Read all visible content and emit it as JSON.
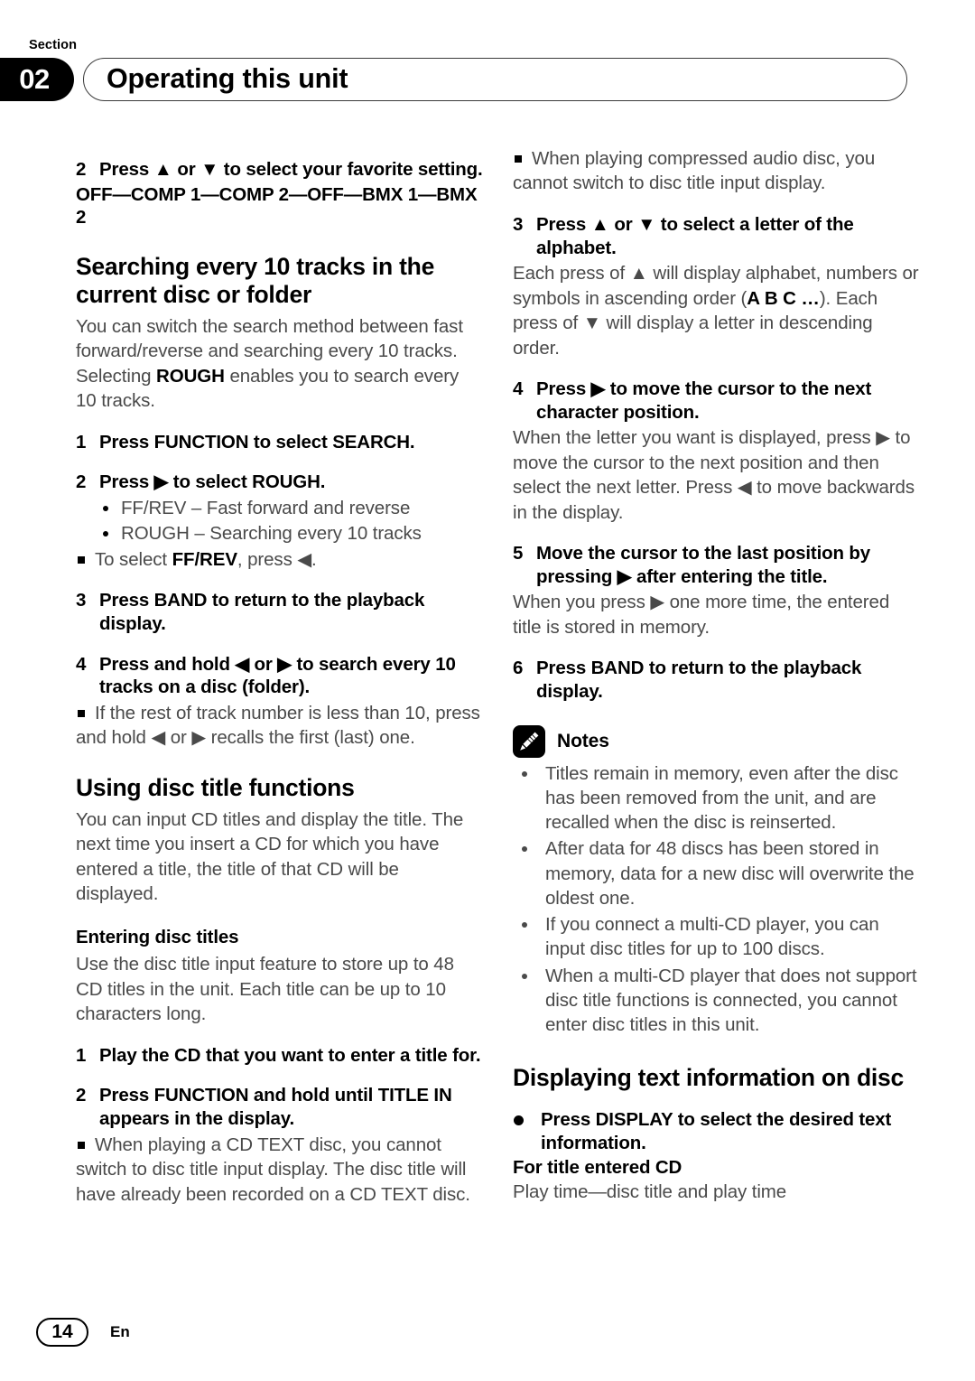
{
  "header": {
    "section_label": "Section",
    "section_number": "02",
    "title": "Operating this unit"
  },
  "footer": {
    "page_number": "14",
    "language_code": "En"
  },
  "left_column": {
    "step2_setting": {
      "number": "2",
      "text": "Press ▲ or ▼ to select your favorite setting.",
      "values": "OFF—COMP 1—COMP 2—OFF—BMX 1—BMX 2"
    },
    "search_section": {
      "heading": "Searching every 10 tracks in the current disc or folder",
      "intro_a": "You can switch the search method between fast forward/reverse and searching every 10 tracks. Selecting ",
      "intro_bold": "ROUGH",
      "intro_b": " enables you to search every 10 tracks.",
      "step1": {
        "number": "1",
        "text": "Press FUNCTION to select SEARCH."
      },
      "step2": {
        "number": "2",
        "text": "Press ▶ to select ROUGH."
      },
      "options": [
        {
          "term": "FF/REV",
          "desc": " – Fast forward and reverse"
        },
        {
          "term": "ROUGH",
          "desc": " – Searching every 10 tracks"
        }
      ],
      "note_a": "To select ",
      "note_bold": "FF/REV",
      "note_b": ", press ◀.",
      "step3": {
        "number": "3",
        "text": "Press BAND to return to the playback display."
      },
      "step4": {
        "number": "4",
        "text": "Press and hold ◀ or ▶ to search every 10 tracks on a disc (folder)."
      },
      "step4_note": "If the rest of track number is less than 10, press and hold ◀ or ▶ recalls the first (last) one."
    },
    "disc_title_section": {
      "heading": "Using disc title functions",
      "intro": "You can input CD titles and display the title. The next time you insert a CD for which you have entered a title, the title of that CD will be displayed.",
      "subheading": "Entering disc titles",
      "sub_intro": "Use the disc title input feature to store up to 48 CD titles in the unit. Each title can be up to 10 characters long.",
      "step1": {
        "number": "1",
        "text": "Play the CD that you want to enter a title for."
      },
      "step2": {
        "number": "2",
        "text": "Press FUNCTION and hold until TITLE IN appears in the display."
      },
      "step2_note": "When playing a CD TEXT disc, you cannot switch to disc title input display. The disc title will have already been recorded on a CD TEXT disc."
    }
  },
  "right_column": {
    "top_note": "When playing compressed audio disc, you cannot switch to disc title input display.",
    "step3": {
      "number": "3",
      "text": "Press ▲ or ▼ to select a letter of the alphabet.",
      "body_a": "Each press of ▲ will display alphabet, numbers or symbols in ascending order (",
      "body_bold": "A B C …",
      "body_b": "). Each press of ▼ will display a letter in descending order."
    },
    "step4": {
      "number": "4",
      "text": "Press ▶ to move the cursor to the next character position.",
      "body": "When the letter you want is displayed, press ▶ to move the cursor to the next position and then select the next letter. Press ◀ to move backwards in the display."
    },
    "step5": {
      "number": "5",
      "text": "Move the cursor to the last position by pressing ▶ after entering the title.",
      "body": "When you press ▶ one more time, the entered title is stored in memory."
    },
    "step6": {
      "number": "6",
      "text": "Press BAND to return to the playback display."
    },
    "notes": {
      "icon": "pencil-icon",
      "title": "Notes",
      "items": [
        "Titles remain in memory, even after the disc has been removed from the unit, and are recalled when the disc is reinserted.",
        "After data for 48 discs has been stored in memory, data for a new disc will overwrite the oldest one.",
        "If you connect a multi-CD player, you can input disc titles for up to 100 discs.",
        "When a multi-CD player that does not support disc title functions is connected, you cannot enter disc titles in this unit."
      ]
    },
    "display_section": {
      "heading": "Displaying text information on disc",
      "step": "Press DISPLAY to select the desired text information.",
      "subhead": "For title entered CD",
      "body": "Play time—disc title and play time"
    }
  }
}
